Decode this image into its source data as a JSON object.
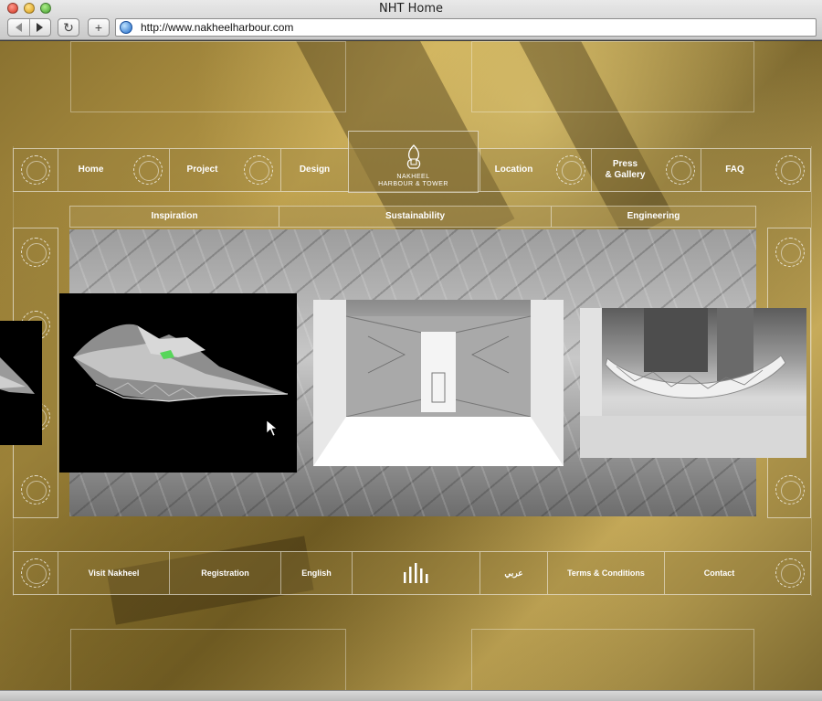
{
  "browser": {
    "window_title": "NHT Home",
    "url": "http://www.nakheelharbour.com",
    "reload_glyph": "↻",
    "add_glyph": "+"
  },
  "logo": {
    "line1": "NAKHEEL",
    "line2": "HARBOUR & TOWER"
  },
  "main_nav": {
    "left": [
      "Home",
      "Project",
      "Design"
    ],
    "right": [
      "Location",
      "Press\n& Gallery",
      "FAQ"
    ]
  },
  "sub_nav": [
    "Inspiration",
    "Sustainability",
    "Engineering"
  ],
  "footer_nav": {
    "left": [
      "Visit Nakheel",
      "Registration",
      "English"
    ],
    "right": [
      "عربي",
      "Terms & Conditions",
      "Contact"
    ]
  },
  "gallery": {
    "panels": [
      "tower-model-render",
      "interior-atrium-render",
      "canopy-structure-render"
    ]
  },
  "colors": {
    "gold": "#a88b3e",
    "panel_dark": "#000000"
  }
}
